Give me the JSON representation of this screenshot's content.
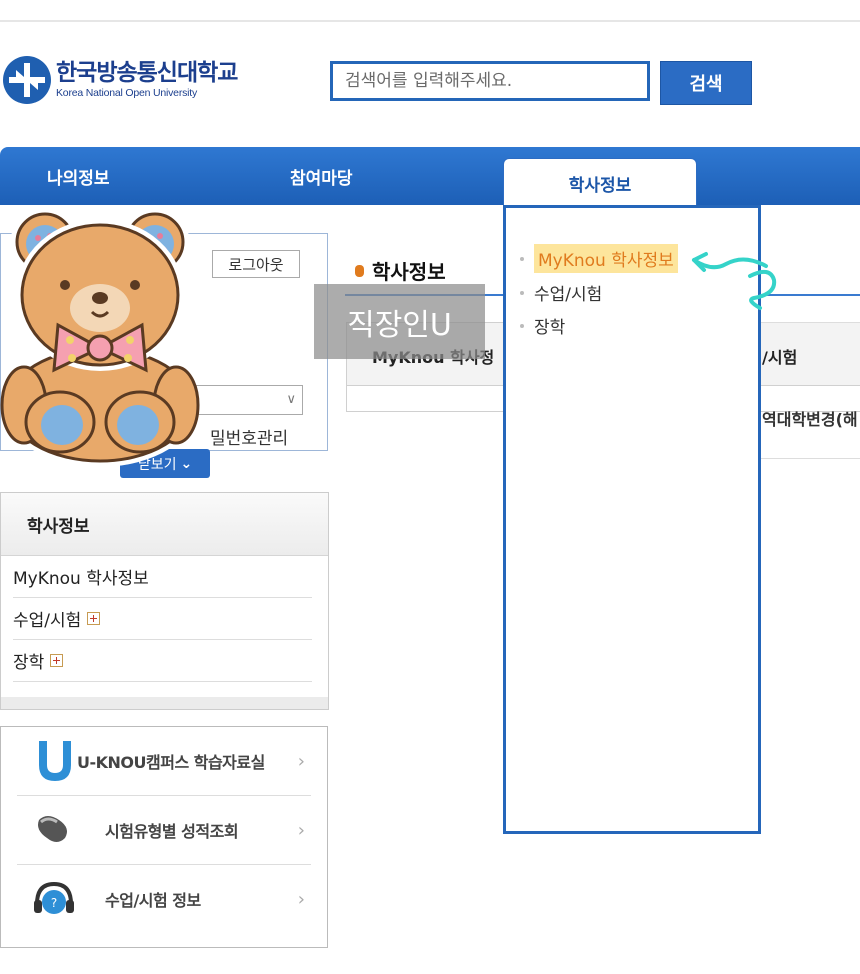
{
  "header": {
    "logo_ko": "한국방송통신대학교",
    "logo_en": "Korea National Open University",
    "search_placeholder": "검색어를 입력해주세요.",
    "search_button": "검색"
  },
  "nav": {
    "items": [
      "나의정보",
      "참여마당",
      "학사정보"
    ],
    "active_index": 2
  },
  "login": {
    "logout": "로그아웃",
    "password_manage": "밀번호관리",
    "more": "닫보기"
  },
  "left_menu": {
    "title": "학사정보",
    "items": [
      "MyKnou 학사정보",
      "수업/시험",
      "장학"
    ]
  },
  "quick_links": [
    {
      "label": "U-KNOU캠퍼스 학습자료실",
      "icon": "u-knou-logo-icon"
    },
    {
      "label": "시험유형별 성적조회",
      "icon": "mouse-icon"
    },
    {
      "label": "수업/시험 정보",
      "icon": "headset-icon"
    }
  ],
  "main": {
    "title": "학사정보",
    "col_left": "MyKnou 학사정",
    "col_right": "/시험",
    "row_right": "역대학변경(해"
  },
  "dropdown": {
    "items": [
      "MyKnou 학사정보",
      "수업/시험",
      "장학"
    ],
    "highlighted_index": 0
  },
  "watermark": "직장인U",
  "colors": {
    "brand_blue": "#2b6cc4",
    "highlight": "#fde59c",
    "active_text": "#e07b1e"
  }
}
